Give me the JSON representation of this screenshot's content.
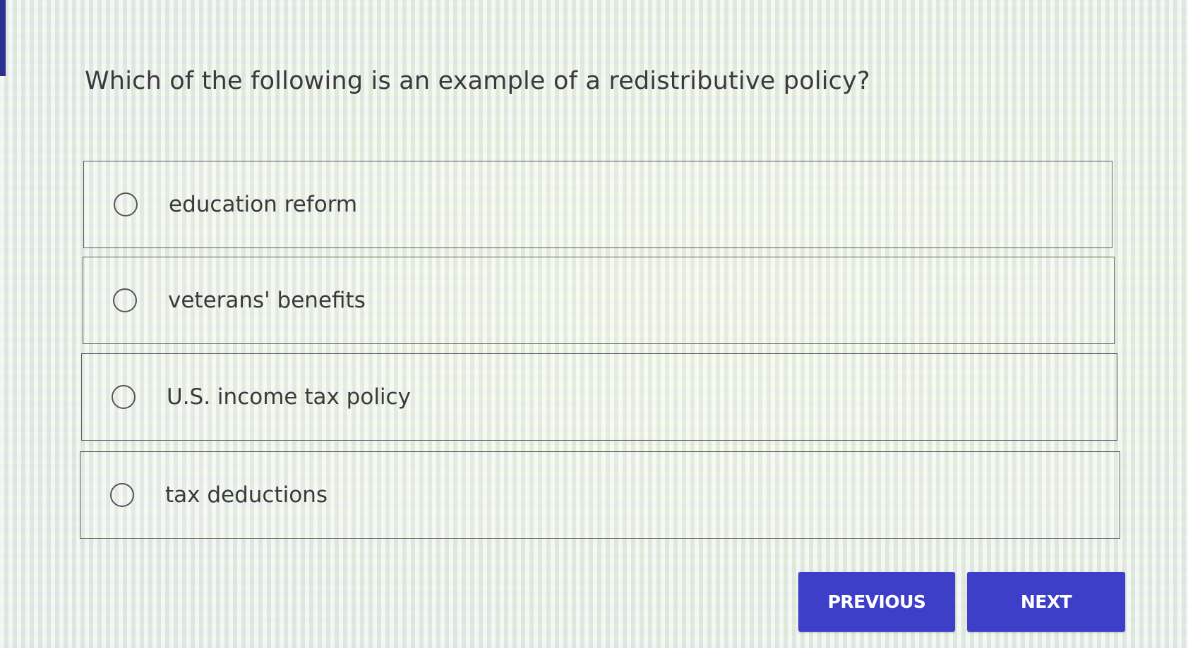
{
  "question": {
    "text": "Which of the following is an example of a redistributive policy?"
  },
  "options": [
    {
      "label": "education reform",
      "selected": false
    },
    {
      "label": "veterans' benefits",
      "selected": false
    },
    {
      "label": "U.S. income tax policy",
      "selected": false
    },
    {
      "label": "tax deductions",
      "selected": false
    }
  ],
  "nav": {
    "previous_label": "PREVIOUS",
    "next_label": "NEXT"
  },
  "colors": {
    "button": "#3e3fc8",
    "accent_bar": "#2b2f8f",
    "text": "#3a3a3a"
  }
}
